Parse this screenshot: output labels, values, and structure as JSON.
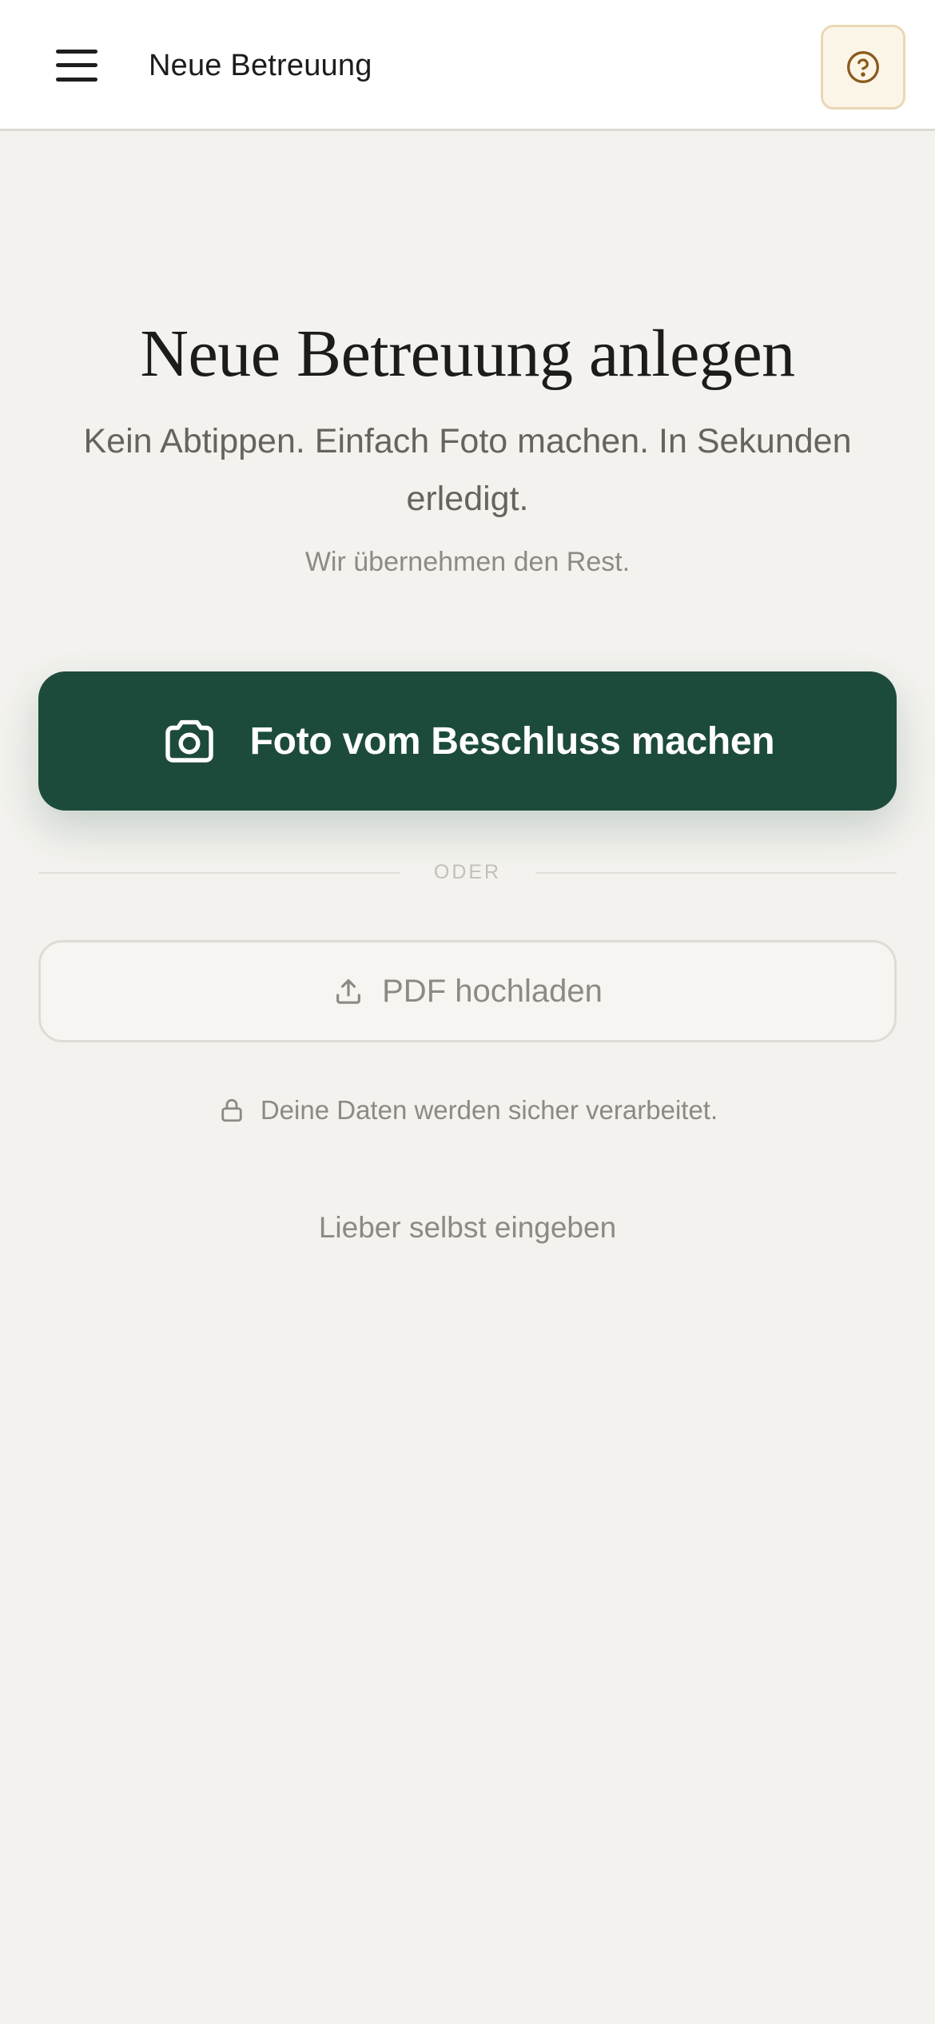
{
  "header": {
    "title": "Neue Betreuung",
    "menu_icon": "menu-icon",
    "help_icon": "help-circle-icon"
  },
  "hero": {
    "title": "Neue Betreuung anlegen",
    "subtitle": "Kein Abtippen. Einfach Foto machen. In Sekunden erledigt.",
    "note": "Wir übernehmen den Rest."
  },
  "actions": {
    "primary_label": "Foto vom Beschluss machen",
    "primary_icon": "camera-icon",
    "divider_label": "ODER",
    "secondary_label": "PDF hochladen",
    "secondary_icon": "upload-icon"
  },
  "security": {
    "text": "Deine Daten werden sicher verarbeitet.",
    "icon": "lock-icon"
  },
  "manual_link": "Lieber selbst eingeben",
  "colors": {
    "background": "#f3f2ee",
    "primary": "#1d4b3b",
    "help_button_bg": "#fbf5e8",
    "help_icon": "#8a5a1c"
  }
}
